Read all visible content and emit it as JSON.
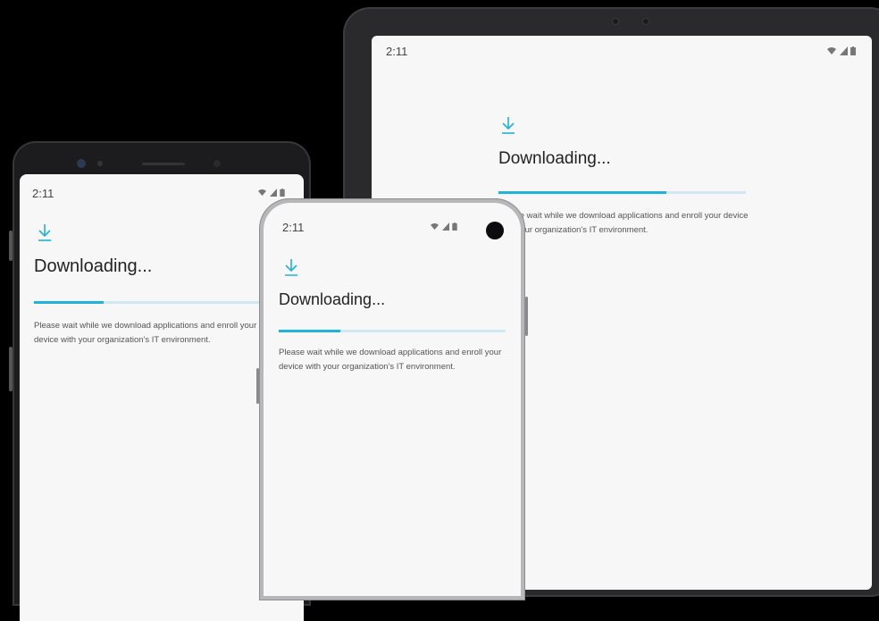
{
  "status": {
    "time": "2:11"
  },
  "screen": {
    "title": "Downloading...",
    "description": "Please wait while we download applications and enroll your device with your organization's IT environment.",
    "progress": 0.33
  },
  "icons": {
    "download": "download-icon",
    "wifi": "wifi-icon",
    "signal": "signal-icon",
    "battery": "battery-icon"
  },
  "colors": {
    "accent": "#1fb3d9",
    "track": "#cfe9f2",
    "screen_bg": "#f7f7f8"
  }
}
